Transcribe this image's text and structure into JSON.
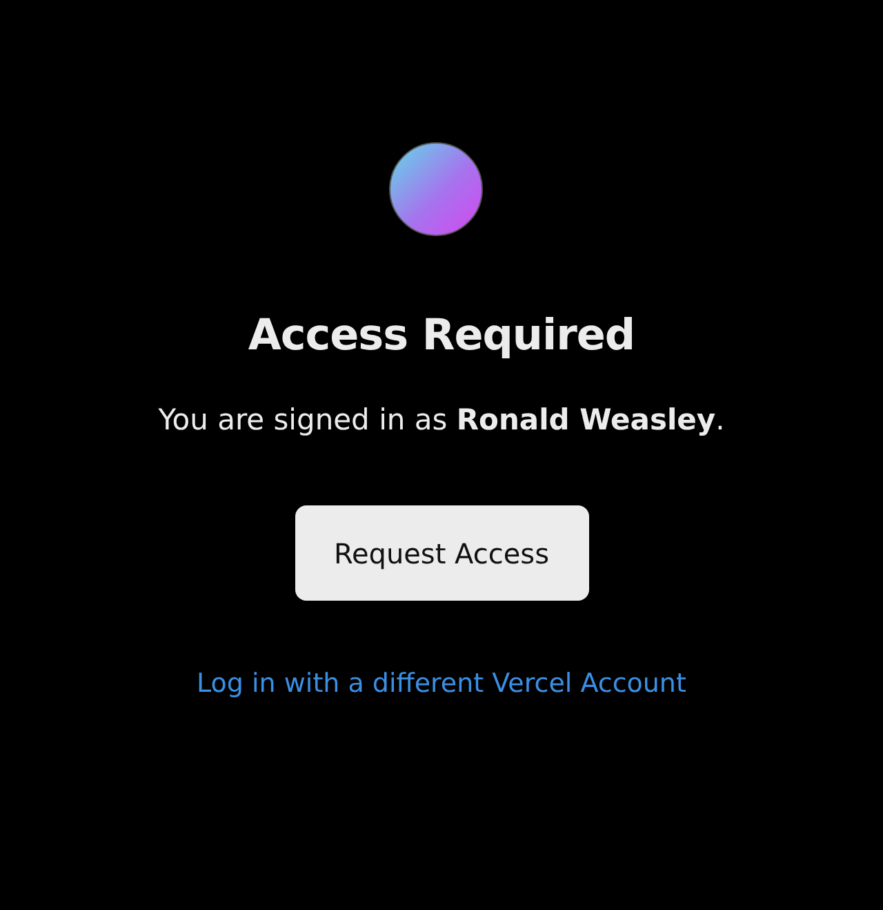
{
  "avatar": {
    "kind": "gradient"
  },
  "title": "Access Required",
  "message": "You are signed in as **Ronald Weasley**.",
  "request_button": "Request Access",
  "switch_account_link": "Log in with a different Vercel Account"
}
